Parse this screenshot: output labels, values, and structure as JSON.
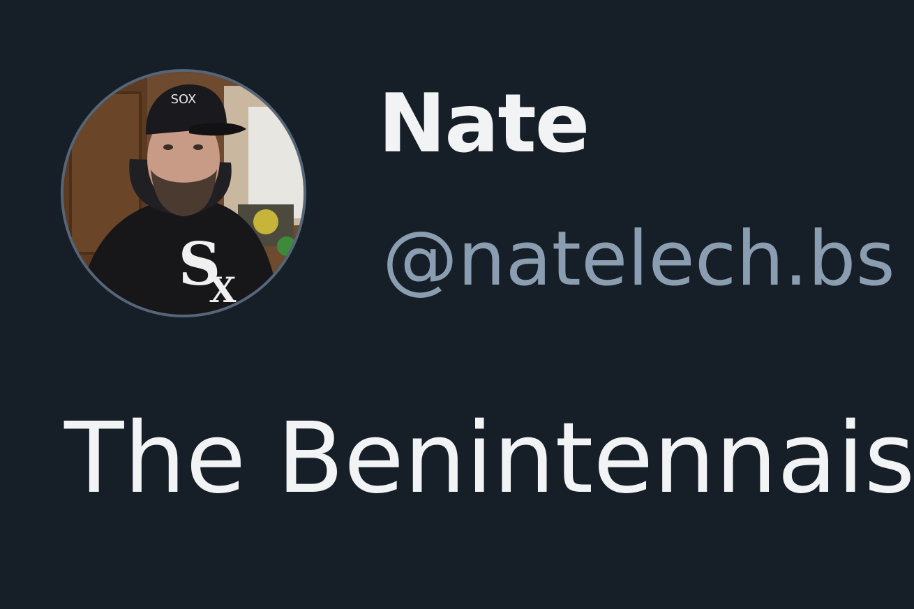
{
  "post": {
    "author": {
      "display_name": "Nate",
      "handle": "@natelech.bs",
      "avatar_icon": "user-avatar-photo"
    },
    "text": "The Benintennais"
  },
  "colors": {
    "background": "#161e27",
    "name_text": "#f1f3f5",
    "handle_text": "#8b9db0",
    "avatar_ring": "#55667a"
  }
}
